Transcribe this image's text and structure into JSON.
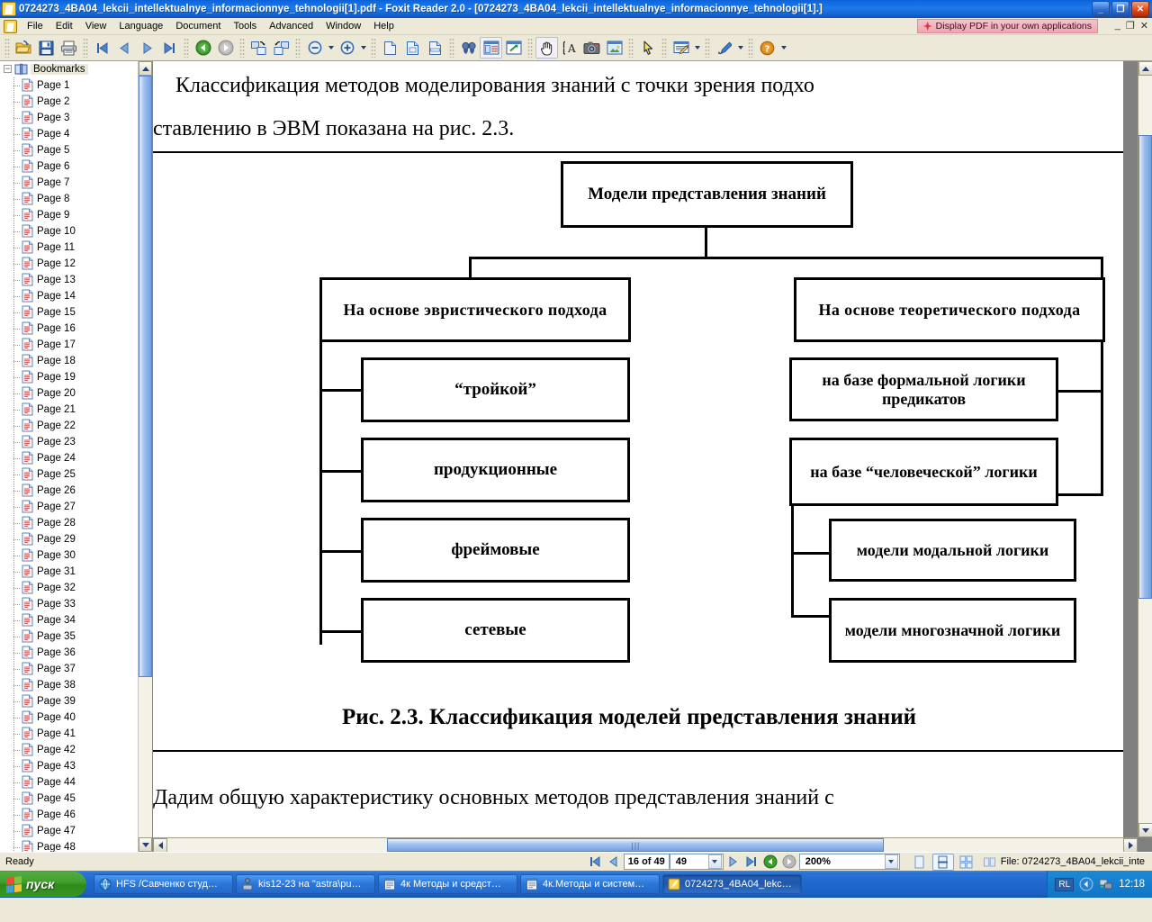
{
  "window": {
    "title": "0724273_4BA04_lekcii_intellektualnye_informacionnye_tehnologii[1].pdf - Foxit Reader 2.0 - [0724273_4BA04_lekcii_intellektualnye_informacionnye_tehnologii[1].]",
    "icon": "foxit-document-icon",
    "minimize": "_",
    "maximize": "❐",
    "close": "✕"
  },
  "menu": {
    "items": [
      "File",
      "Edit",
      "View",
      "Language",
      "Document",
      "Tools",
      "Advanced",
      "Window",
      "Help"
    ],
    "ad_banner": "Display PDF in your own applications",
    "mdi": {
      "minimize": "_",
      "restore": "❐",
      "close": "✕"
    }
  },
  "toolbar": {
    "groups": [
      {
        "buttons": [
          {
            "name": "open-icon",
            "title": "Open"
          },
          {
            "name": "save-icon",
            "title": "Save"
          },
          {
            "name": "print-icon",
            "title": "Print"
          }
        ]
      },
      {
        "buttons": [
          {
            "name": "first-page-icon",
            "title": "First Page"
          },
          {
            "name": "previous-page-icon",
            "title": "Previous Page"
          },
          {
            "name": "next-page-icon",
            "title": "Next Page"
          },
          {
            "name": "last-page-icon",
            "title": "Last Page"
          }
        ]
      },
      {
        "buttons": [
          {
            "name": "go-back-icon",
            "title": "Previous View"
          },
          {
            "name": "go-forward-icon",
            "title": "Next View"
          }
        ]
      },
      {
        "buttons": [
          {
            "name": "rotate-clockwise-icon",
            "title": "Rotate Clockwise"
          },
          {
            "name": "rotate-counterclockwise-icon",
            "title": "Rotate Counterclockwise"
          }
        ]
      },
      {
        "buttons": [
          {
            "name": "zoom-out-icon",
            "title": "Zoom Out"
          },
          {
            "name": "zoom-out-dropdown",
            "title": "Zoom Out Options"
          },
          {
            "name": "zoom-in-icon",
            "title": "Zoom In"
          },
          {
            "name": "zoom-in-dropdown",
            "title": "Zoom In Options"
          }
        ]
      },
      {
        "buttons": [
          {
            "name": "actual-size-icon",
            "title": "Actual Size"
          },
          {
            "name": "fit-page-icon",
            "title": "Fit Page"
          },
          {
            "name": "fit-width-icon",
            "title": "Fit Width"
          },
          {
            "name": "fit-visible-icon",
            "title": "Fit Visible"
          }
        ]
      },
      {
        "buttons": [
          {
            "name": "find-icon",
            "title": "Find"
          },
          {
            "name": "show-bookmarks-icon",
            "title": "Bookmarks Panel"
          },
          {
            "name": "open-external-icon",
            "title": "Open in Browser"
          }
        ]
      },
      {
        "buttons": [
          {
            "name": "hand-tool-icon",
            "title": "Hand Tool"
          },
          {
            "name": "select-text-icon",
            "title": "Select Text"
          },
          {
            "name": "snapshot-icon",
            "title": "Snapshot"
          },
          {
            "name": "image-tool-icon",
            "title": "Select Image"
          }
        ]
      },
      {
        "buttons": [
          {
            "name": "select-pointer-icon",
            "title": "Select Annotations"
          }
        ]
      },
      {
        "buttons": [
          {
            "name": "text-box-tool-icon",
            "title": "Text Box Tool"
          },
          {
            "name": "text-box-dropdown",
            "title": "Text Box Options"
          }
        ]
      },
      {
        "buttons": [
          {
            "name": "drawing-tool-icon",
            "title": "Drawing Tool"
          },
          {
            "name": "drawing-dropdown",
            "title": "Drawing Options"
          }
        ]
      },
      {
        "buttons": [
          {
            "name": "help-icon",
            "title": "Help"
          },
          {
            "name": "help-dropdown",
            "title": "Help Options"
          }
        ]
      }
    ]
  },
  "bookmarks": {
    "root_label": "Bookmarks",
    "expander": "−",
    "items": [
      "Page 1",
      "Page 2",
      "Page 3",
      "Page 4",
      "Page 5",
      "Page 6",
      "Page 7",
      "Page 8",
      "Page 9",
      "Page 10",
      "Page 11",
      "Page 12",
      "Page 13",
      "Page 14",
      "Page 15",
      "Page 16",
      "Page 17",
      "Page 18",
      "Page 19",
      "Page 20",
      "Page 21",
      "Page 22",
      "Page 23",
      "Page 24",
      "Page 25",
      "Page 26",
      "Page 27",
      "Page 28",
      "Page 29",
      "Page 30",
      "Page 31",
      "Page 32",
      "Page 33",
      "Page 34",
      "Page 35",
      "Page 36",
      "Page 37",
      "Page 38",
      "Page 39",
      "Page 40",
      "Page 41",
      "Page 42",
      "Page 43",
      "Page 44",
      "Page 45",
      "Page 46",
      "Page 47",
      "Page 48"
    ]
  },
  "document": {
    "paragraph_1": "Классификация  методов  моделирования  знаний  с  точки  зрения  подхо",
    "paragraph_2": "ставлению в ЭВМ показана на рис. 2.3.",
    "caption": "Рис. 2.3. Классификация моделей представления знаний",
    "paragraph_3": "Дадим  общую  характеристику  основных  методов  представления  знаний  с"
  },
  "chart_data": {
    "type": "diagram",
    "title": "Рис. 2.3. Классификация моделей представления знаний",
    "root": "Модели представления знаний",
    "branches": [
      {
        "label": "На  основе  эвристического подхода",
        "children": [
          "“тройкой”",
          "продукционные",
          "фреймовые",
          "сетевые"
        ]
      },
      {
        "label": "На  основе  теоретического подхода",
        "children": [
          {
            "label": "на базе формальной логики предикатов",
            "children": []
          },
          {
            "label": "на базе “человеческой” логики",
            "children": [
              "модели модальной логики",
              "модели многозначной логики"
            ]
          }
        ]
      }
    ]
  },
  "statusbar": {
    "ready": "Ready",
    "first_page_icon": "first-page-icon",
    "prev_page_icon": "previous-page-icon",
    "page_current": "16 of 49",
    "page_total_value": "49",
    "next_page_icon": "next-page-icon",
    "last_page_icon": "last-page-icon",
    "rotate_cw_icon": "rotate-clockwise-icon",
    "rotate_ccw_icon": "rotate-counterclockwise-icon",
    "zoom_value": "200%",
    "view_single": "single-page-view-icon",
    "view_continuous": "continuous-view-icon",
    "view_facing": "facing-pages-icon",
    "view_continuous_facing": "continuous-facing-icon",
    "file_label": "File: 0724273_4BA04_lekcii_inte"
  },
  "taskbar": {
    "start": "пуск",
    "tasks": [
      {
        "label": "HFS /Савченко студ…",
        "icon": "browser-icon",
        "active": false
      },
      {
        "label": "kis12-23 на \"astra\\pu…",
        "icon": "network-icon",
        "active": false
      },
      {
        "label": "4к Методы и средст…",
        "icon": "word-doc-icon",
        "active": false
      },
      {
        "label": "4к.Методы и систем…",
        "icon": "word-doc-icon",
        "active": false
      },
      {
        "label": "0724273_4BA04_lekc…",
        "icon": "foxit-document-icon",
        "active": true
      }
    ],
    "tray": {
      "language": "RL",
      "network_icon": "network-tray-icon",
      "back_icon": "show-hidden-icon",
      "clock": "12:18"
    }
  },
  "colors": {
    "titlebar_blue": "#1f7aea",
    "chrome": "#ece9d8",
    "page_white": "#ffffff",
    "viewer_gray": "#808080",
    "taskbar_blue": "#2169cf",
    "start_green": "#3c9a28"
  }
}
